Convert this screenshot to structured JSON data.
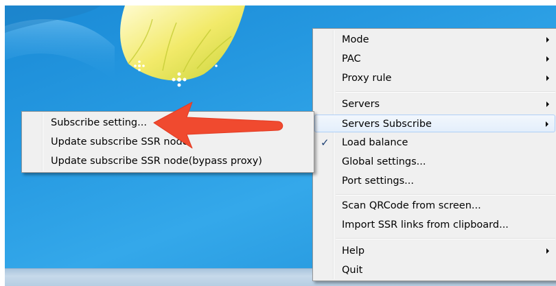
{
  "main_menu": {
    "groups": [
      [
        {
          "label": "Mode",
          "submenu": true
        },
        {
          "label": "PAC",
          "submenu": true
        },
        {
          "label": "Proxy rule",
          "submenu": true
        }
      ],
      [
        {
          "label": "Servers",
          "submenu": true
        },
        {
          "label": "Servers Subscribe",
          "submenu": true,
          "highlighted": true
        },
        {
          "label": "Load balance",
          "checked": true
        },
        {
          "label": "Global settings..."
        },
        {
          "label": "Port settings..."
        }
      ],
      [
        {
          "label": "Scan QRCode from screen..."
        },
        {
          "label": "Import SSR links from clipboard..."
        }
      ],
      [
        {
          "label": "Help",
          "submenu": true
        },
        {
          "label": "Quit"
        }
      ]
    ]
  },
  "sub_menu": {
    "items": [
      {
        "label": "Subscribe setting..."
      },
      {
        "label": "Update subscribe SSR node"
      },
      {
        "label": "Update subscribe SSR node(bypass proxy)"
      }
    ]
  },
  "check_glyph": "✓",
  "colors": {
    "desktop": "#2598e0",
    "menu_bg": "#f0f0f0",
    "highlight_border": "#aecff7",
    "annotation_arrow": "#f04a2f"
  }
}
